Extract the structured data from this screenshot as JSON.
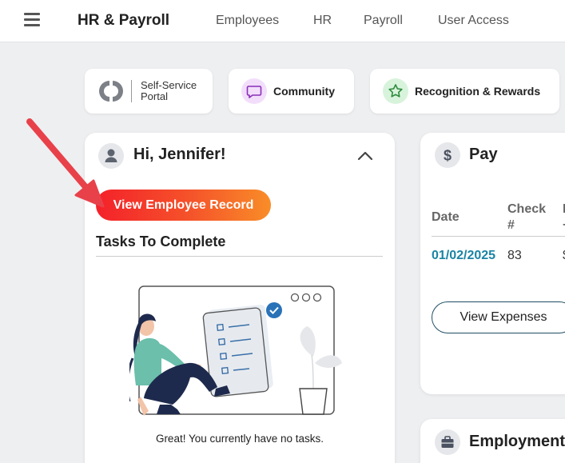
{
  "header": {
    "title": "HR & Payroll",
    "nav": [
      "Employees",
      "HR",
      "Payroll",
      "User Access"
    ]
  },
  "quick_links": {
    "ssp_line1": "Self-Service",
    "ssp_line2": "Portal",
    "community": "Community",
    "recognition": "Recognition & Rewards"
  },
  "welcome_card": {
    "title": "Hi, Jennifer!",
    "view_record_button": "View Employee Record",
    "tasks_title": "Tasks To Complete",
    "empty_message": "Great! You currently have no tasks."
  },
  "pay_card": {
    "title": "Pay",
    "col_date": "Date",
    "col_check_line1": "Check",
    "col_check_line2": "#",
    "row_date": "01/02/2025",
    "row_check": "83",
    "view_expenses_button": "View Expenses"
  },
  "employment_card": {
    "title": "Employment"
  },
  "colors": {
    "accent_teal": "#1a84a5",
    "button_gradient_start": "#f4212a",
    "button_gradient_end": "#f98d28",
    "annotation_arrow": "#e8414a"
  },
  "icons": [
    "menu-icon",
    "self-service-logo",
    "chat-bubble-icon",
    "star-icon",
    "user-icon",
    "chevron-up-icon",
    "dollar-icon",
    "briefcase-icon",
    "annotation-arrow"
  ]
}
